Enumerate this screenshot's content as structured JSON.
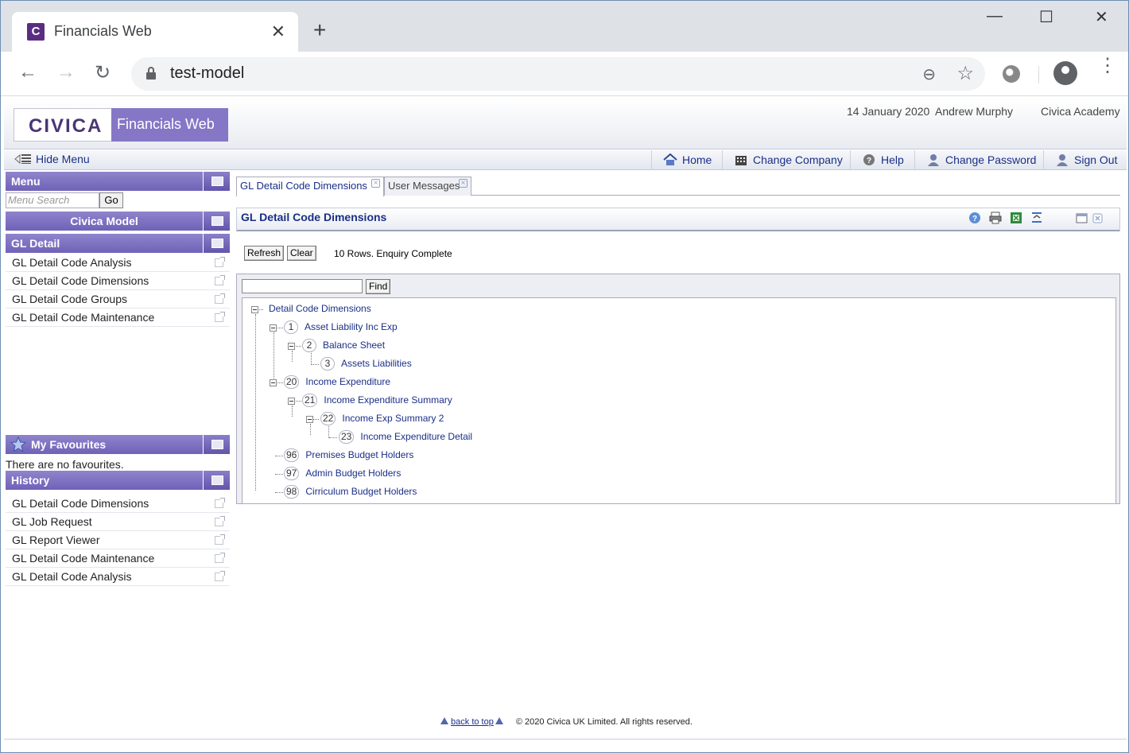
{
  "browser": {
    "tab_title": "Financials Web",
    "favicon_letter": "C",
    "close_glyph": "✕",
    "newtab_glyph": "+",
    "url": "test-model",
    "minimize_glyph": "—",
    "maximize_glyph": "☐",
    "closewin_glyph": "✕",
    "back_glyph": "←",
    "forward_glyph": "→",
    "reload_glyph": "↻",
    "zoom_glyph": "⊖",
    "star_glyph": "☆",
    "kebab_glyph": "⋮"
  },
  "header": {
    "logo_text": "CIVICA",
    "product_name": "Financials Web",
    "date": "14 January 2020",
    "user": "Andrew Murphy",
    "organisation": "Civica Academy"
  },
  "menubar": {
    "hide_menu": "Hide Menu",
    "home": "Home",
    "change_company": "Change Company",
    "help": "Help",
    "change_password": "Change Password",
    "sign_out": "Sign Out"
  },
  "sidebar": {
    "menu_title": "Menu",
    "menu_search_placeholder": "Menu Search",
    "go_label": "Go",
    "model_title": "Civica Model",
    "group_title": "GL Detail",
    "items": [
      {
        "label": "GL Detail Code Analysis"
      },
      {
        "label": "GL Detail Code Dimensions"
      },
      {
        "label": "GL Detail Code Groups"
      },
      {
        "label": "GL Detail Code Maintenance"
      }
    ],
    "favourites_title": "My Favourites",
    "favourites_empty": "There are no favourites.",
    "history_title": "History",
    "history": [
      {
        "label": "GL Detail Code Dimensions"
      },
      {
        "label": "GL Job Request"
      },
      {
        "label": "GL Report Viewer"
      },
      {
        "label": "GL Detail Code Maintenance"
      },
      {
        "label": "GL Detail Code Analysis"
      }
    ]
  },
  "tabs": [
    {
      "label": "GL Detail Code Dimensions",
      "active": true
    },
    {
      "label": "User Messages",
      "active": false
    }
  ],
  "panel": {
    "title": "GL Detail Code Dimensions",
    "refresh_label": "Refresh",
    "clear_label": "Clear",
    "status": "10 Rows. Enquiry Complete",
    "find_label": "Find"
  },
  "tree": {
    "root": "Detail Code Dimensions",
    "nodes": [
      {
        "num": "1",
        "label": "Asset Liability Inc Exp"
      },
      {
        "num": "2",
        "label": "Balance Sheet"
      },
      {
        "num": "3",
        "label": "Assets Liabilities"
      },
      {
        "num": "20",
        "label": "Income Expenditure"
      },
      {
        "num": "21",
        "label": "Income Expenditure Summary"
      },
      {
        "num": "22",
        "label": "Income Exp Summary 2"
      },
      {
        "num": "23",
        "label": "Income Expenditure Detail"
      },
      {
        "num": "96",
        "label": "Premises Budget Holders"
      },
      {
        "num": "97",
        "label": "Admin Budget Holders"
      },
      {
        "num": "98",
        "label": "Cirriculum Budget Holders"
      }
    ]
  },
  "footer": {
    "back_to_top": "back to top",
    "copyright": "© 2020 Civica UK Limited. All rights reserved."
  },
  "colors": {
    "brand_purple": "#8577c6",
    "link_blue": "#1a2f87"
  }
}
